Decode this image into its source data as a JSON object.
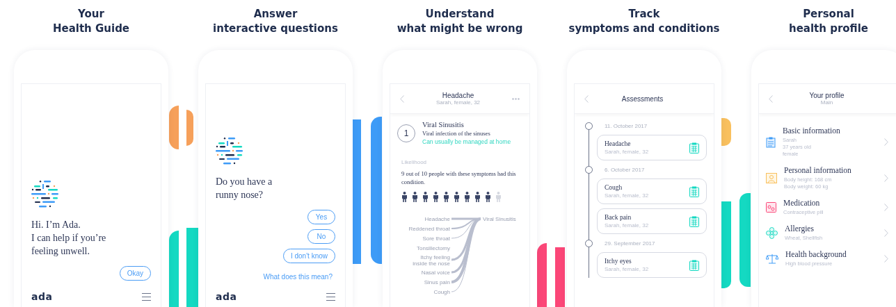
{
  "panels": [
    {
      "kind": "chat",
      "caption": [
        "Your",
        "Health Guide"
      ],
      "message": [
        "Hi. I’m Ada.",
        "I can help if you’re",
        "feeling unwell."
      ],
      "replies": [
        "Okay"
      ],
      "footer_logo": "ada"
    },
    {
      "kind": "chat",
      "caption": [
        "Answer",
        "interactive questions"
      ],
      "message": [
        "Do you have a",
        "runny nose?"
      ],
      "replies": [
        "Yes",
        "No",
        "I don't know"
      ],
      "link": "What does this mean?",
      "footer_logo": "ada"
    },
    {
      "kind": "result",
      "caption": [
        "Understand",
        "what might be wrong"
      ],
      "header": {
        "title": "Headache",
        "subtitle": "Sarah, female, 32"
      },
      "rank": "1",
      "condition": "Viral Sinusitis",
      "description": "Viral infection of the sinuses",
      "advice": "Can usually be managed at home",
      "likelihood_label": "Likelihood",
      "likelihood_text": "9 out of 10 people with these symptoms had this condition.",
      "people": [
        {
          "filled": true
        },
        {
          "filled": true
        },
        {
          "filled": true
        },
        {
          "filled": true
        },
        {
          "filled": true
        },
        {
          "filled": true
        },
        {
          "filled": true
        },
        {
          "filled": true
        },
        {
          "filled": true
        },
        {
          "filled": false
        }
      ],
      "symptoms": [
        {
          "lines": [
            "Headache"
          ]
        },
        {
          "lines": [
            "Reddened throat"
          ]
        },
        {
          "lines": [
            "Sore throat"
          ]
        },
        {
          "lines": [
            "Tonsillectomy"
          ]
        },
        {
          "lines": [
            "Itchy feeling",
            "inside the nose"
          ]
        },
        {
          "lines": [
            "Nasal voice"
          ]
        },
        {
          "lines": [
            "Sinus pain"
          ]
        },
        {
          "lines": [
            "Cough"
          ]
        }
      ],
      "target": "Viral Sinusitis"
    },
    {
      "kind": "timeline",
      "caption": [
        "Track",
        "symptoms and conditions"
      ],
      "header": {
        "title": "Assessments"
      },
      "groups": [
        {
          "date": "11. October 2017",
          "items": [
            {
              "title": "Headache",
              "subtitle": "Sarah, female, 32"
            }
          ]
        },
        {
          "date": "6. October 2017",
          "items": [
            {
              "title": "Cough",
              "subtitle": "Sarah, female, 32"
            },
            {
              "title": "Back pain",
              "subtitle": "Sarah, female, 32"
            }
          ]
        },
        {
          "date": "29. September 2017",
          "items": [
            {
              "title": "Itchy eyes",
              "subtitle": "Sarah, female, 32"
            }
          ]
        }
      ]
    },
    {
      "kind": "profile",
      "caption": [
        "Personal",
        "health profile"
      ],
      "header": {
        "title": "Your profile",
        "subtitle": "Main"
      },
      "items": [
        {
          "title": "Basic information",
          "lines": [
            "Sarah",
            "37 years old",
            "female"
          ]
        },
        {
          "title": "Personal information",
          "lines": [
            "Body height: 168 cm",
            "Body weight: 60 kg"
          ]
        },
        {
          "title": "Medication",
          "lines": [
            "Contraceptive pill"
          ]
        },
        {
          "title": "Allergies",
          "lines": [
            "Wheat, Shellfish"
          ]
        },
        {
          "title": "Health background",
          "lines": [
            "High blood pressure"
          ]
        }
      ]
    }
  ]
}
